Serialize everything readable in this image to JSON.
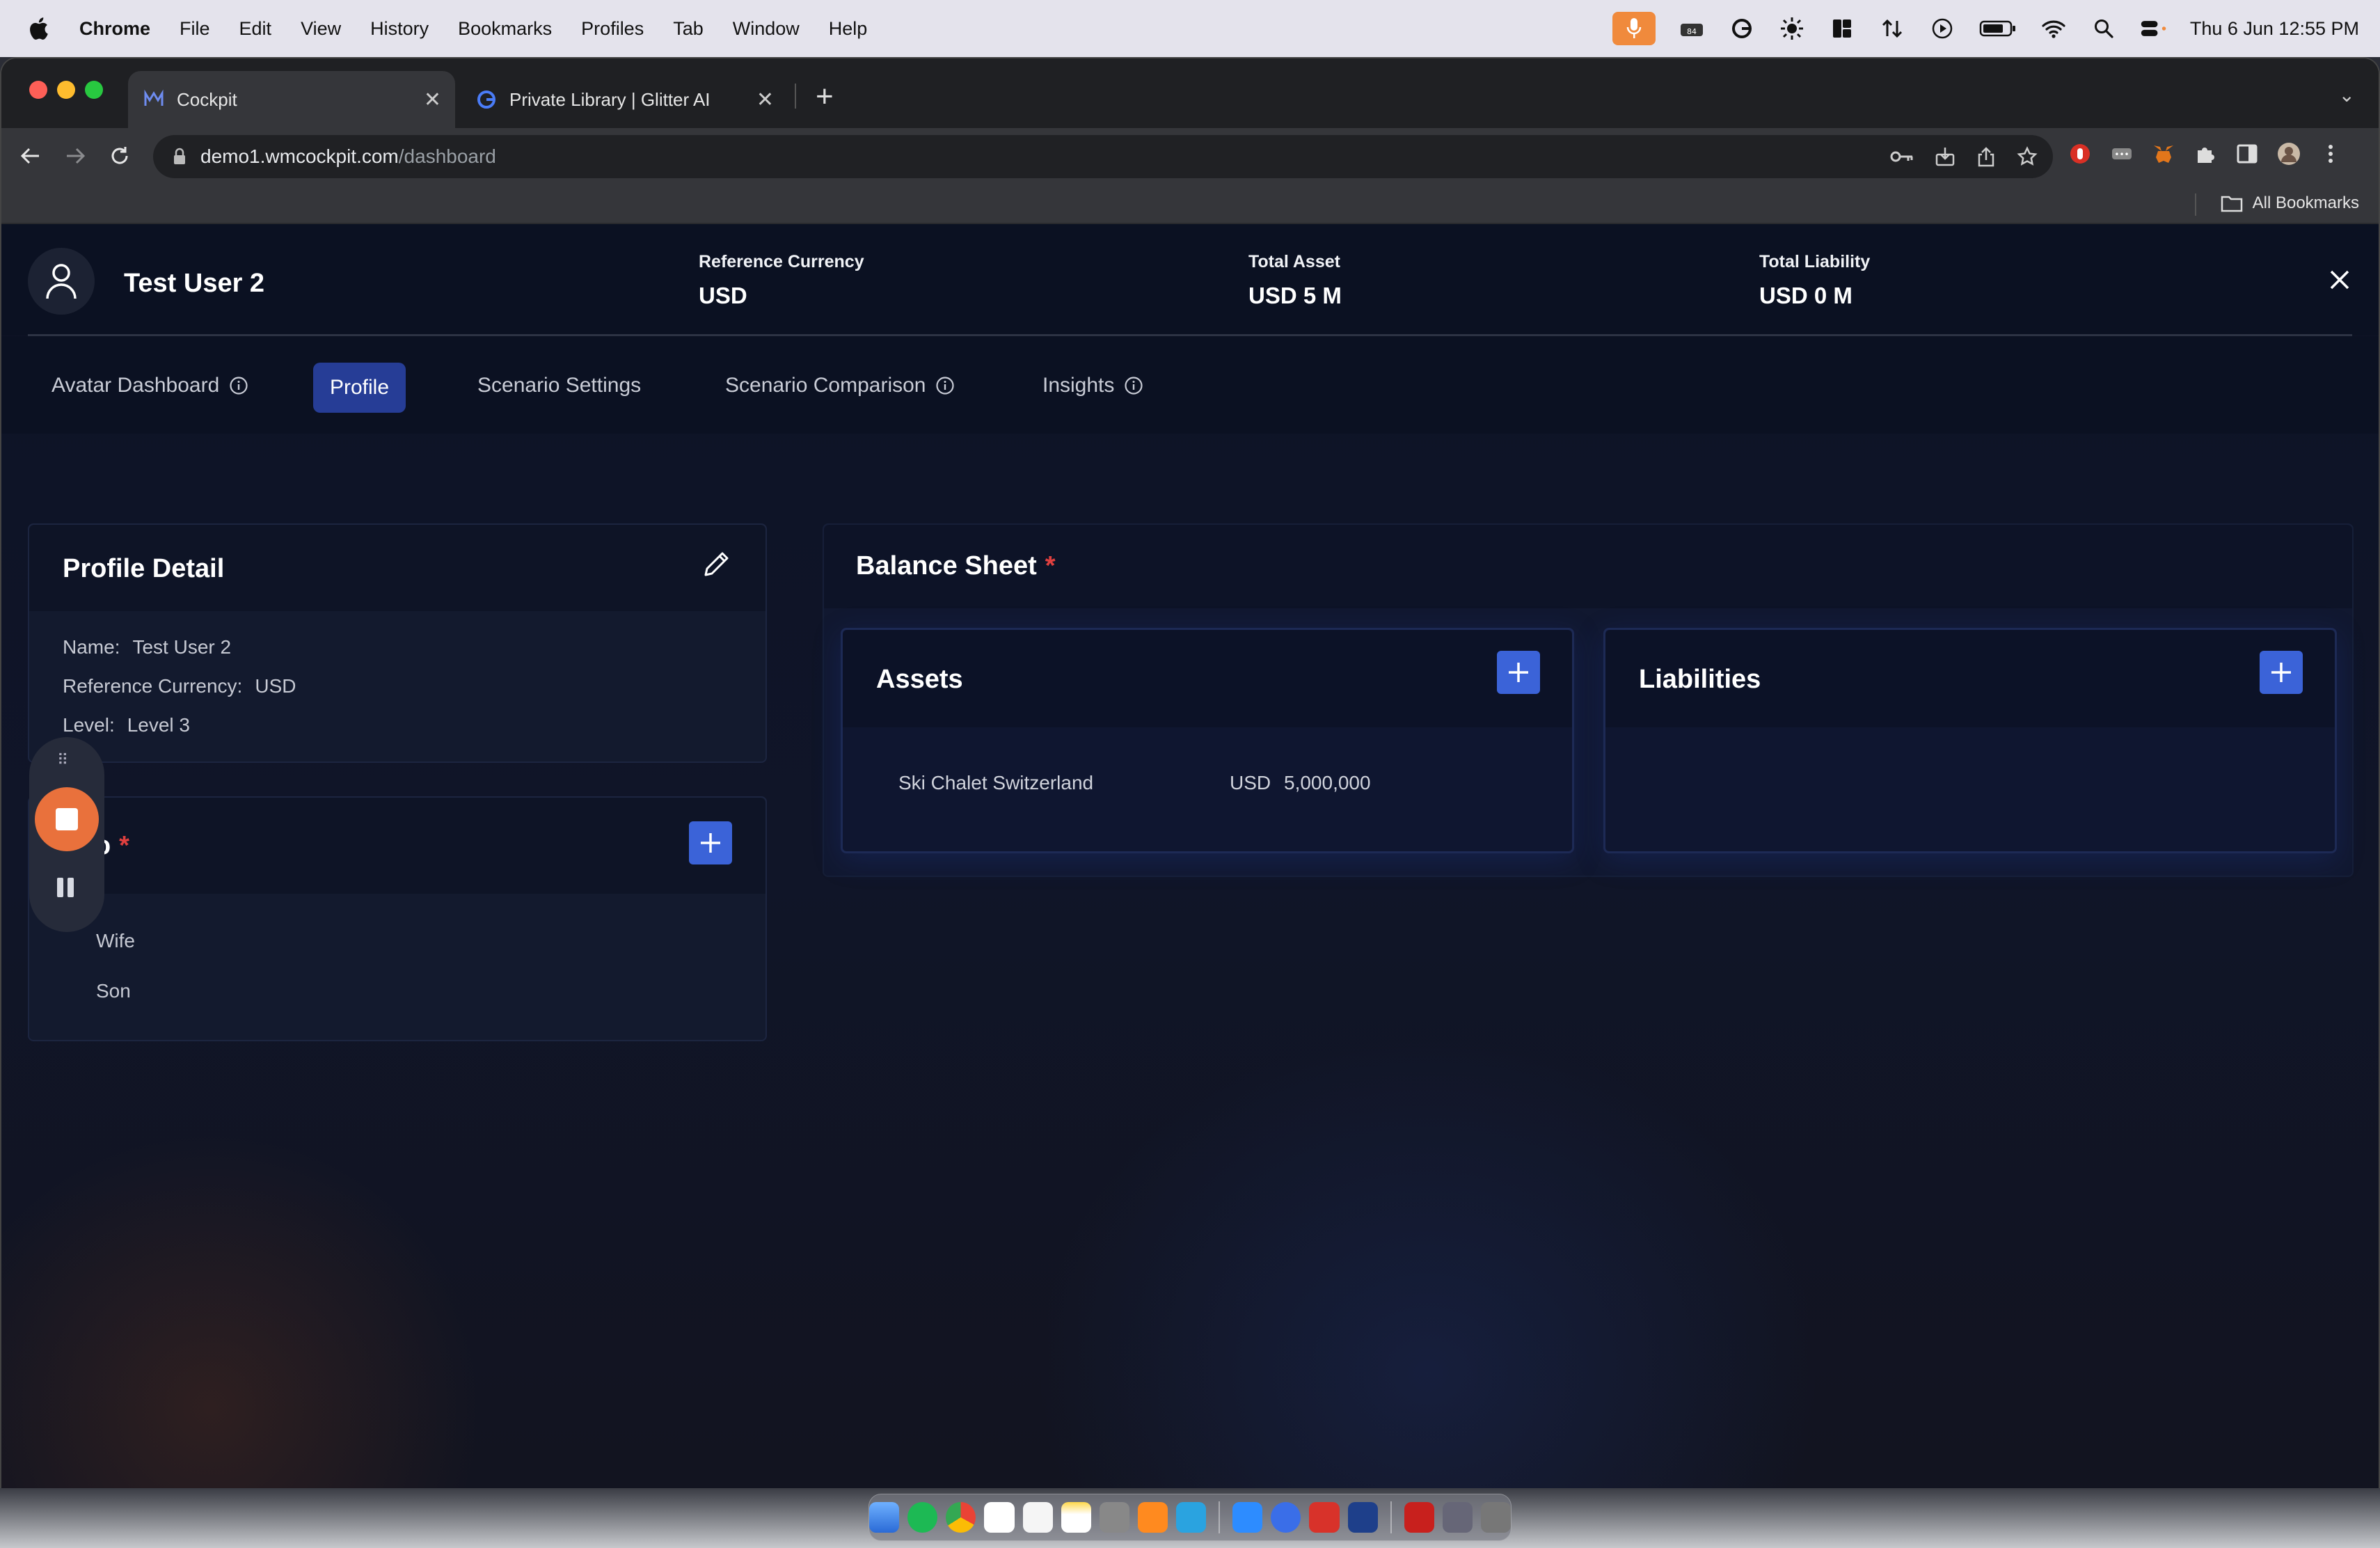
{
  "menubar": {
    "app": "Chrome",
    "items": [
      "File",
      "Edit",
      "View",
      "History",
      "Bookmarks",
      "Profiles",
      "Tab",
      "Window",
      "Help"
    ],
    "clock": "Thu 6 Jun  12:55 PM"
  },
  "browser": {
    "tabs": [
      {
        "title": "Cockpit",
        "active": true
      },
      {
        "title": "Private Library | Glitter AI",
        "active": false
      }
    ],
    "url_host": "demo1.wmcockpit.com",
    "url_path": "/dashboard",
    "all_bookmarks": "All Bookmarks"
  },
  "header": {
    "user_name": "Test User 2",
    "kpis": [
      {
        "label": "Reference Currency",
        "value": "USD"
      },
      {
        "label": "Total Asset",
        "value": "USD 5 M"
      },
      {
        "label": "Total Liability",
        "value": "USD 0 M"
      }
    ]
  },
  "nav": {
    "avatar_dashboard": "Avatar Dashboard",
    "profile": "Profile",
    "scenario_settings": "Scenario Settings",
    "scenario_comparison": "Scenario Comparison",
    "insights": "Insights"
  },
  "profile_detail": {
    "title": "Profile Detail",
    "name_label": "Name:",
    "name_value": "Test User 2",
    "currency_label": "Reference Currency:",
    "currency_value": "USD",
    "level_label": "Level:",
    "level_value": "Level 3"
  },
  "family": {
    "title_fragment": "ɔ",
    "members": [
      "Wife",
      "Son"
    ]
  },
  "balance_sheet": {
    "title": "Balance Sheet",
    "assets_title": "Assets",
    "liabilities_title": "Liabilities",
    "assets": [
      {
        "name": "Ski Chalet Switzerland",
        "currency": "USD",
        "amount": "5,000,000"
      }
    ]
  },
  "colors": {
    "accent": "#3b63d8",
    "nav_active": "#263d96",
    "required": "#e0403f",
    "recorder": "#e9713c"
  }
}
